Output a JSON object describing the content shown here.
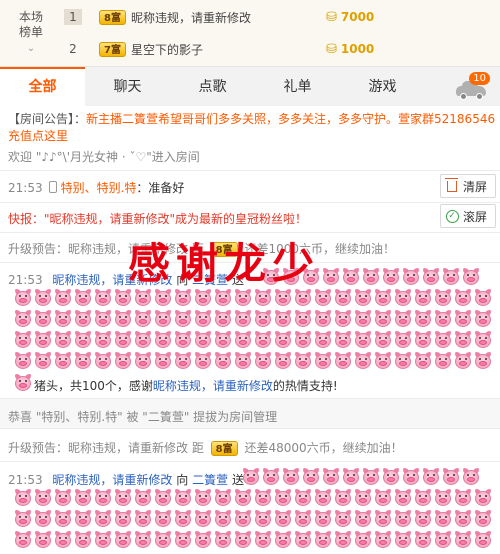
{
  "ranking": {
    "side_label": "本场榜单",
    "chevron_icon": "chevron-down-icon",
    "rows": [
      {
        "rank": "1",
        "level": "8富",
        "name": "昵称违规，请重新修改",
        "coin_icon": "coin-stack-icon",
        "amount": "7000"
      },
      {
        "rank": "2",
        "level": "7富",
        "name": "星空下的影子",
        "coin_icon": "coin-stack-icon",
        "amount": "1000"
      }
    ]
  },
  "tabs": [
    {
      "label": "全部",
      "active": true
    },
    {
      "label": "聊天",
      "active": false
    },
    {
      "label": "点歌",
      "active": false
    },
    {
      "label": "礼单",
      "active": false
    },
    {
      "label": "游戏",
      "active": false
    }
  ],
  "car": {
    "icon": "car-icon",
    "badge": "10"
  },
  "chat": {
    "notice_label": "【房间公告】：",
    "notice_text": "新主播二簀萱希望哥哥们多多关照，多多关注，多多守护。萱家群52186546",
    "notice_line2": "充值点这里",
    "welcome_prefix": "欢迎",
    "welcome_name": "\"♪♪°\\'月光女神 · ˇ♡\"",
    "welcome_suffix": "进入房间",
    "msg1": {
      "time": "21:53",
      "user": "特别、特别.特",
      "text": "：准备好"
    },
    "clear_btn": "清屏",
    "scroll_btn": "滚屏",
    "flash": "快报：\"昵称违规，请重新修改\"成为最新的皇冠粉丝啦！",
    "upgrade1": {
      "prefix": "升级预告：昵称违规，请重新修改 距",
      "level": "8富",
      "suffix": "还差1000六币，继续加油！"
    },
    "gift1": {
      "time": "21:53",
      "from": "昵称违规，请重新修改",
      "to_word": "向",
      "to": "二簀萱",
      "send": "送"
    },
    "gift1_summary": {
      "item": "猪头，共100个，感谢",
      "user": "昵称违规，请重新修改",
      "end": "的热情支持!"
    },
    "promote": "恭喜 \"特别、特别.特\" 被 \"二簀萱\" 提拔为房间管理",
    "upgrade2": {
      "prefix": "升级预告：昵称违规，请重新修改 距",
      "level": "8富",
      "suffix": "还差48000六币，继续加油！"
    },
    "gift2": {
      "time": "21:53",
      "from": "昵称违规，请重新修改",
      "to_word": "向",
      "to": "二簀萱",
      "send": "送"
    },
    "gift_icon": "pig-head-icon"
  },
  "overlay_text": "感谢龙少"
}
